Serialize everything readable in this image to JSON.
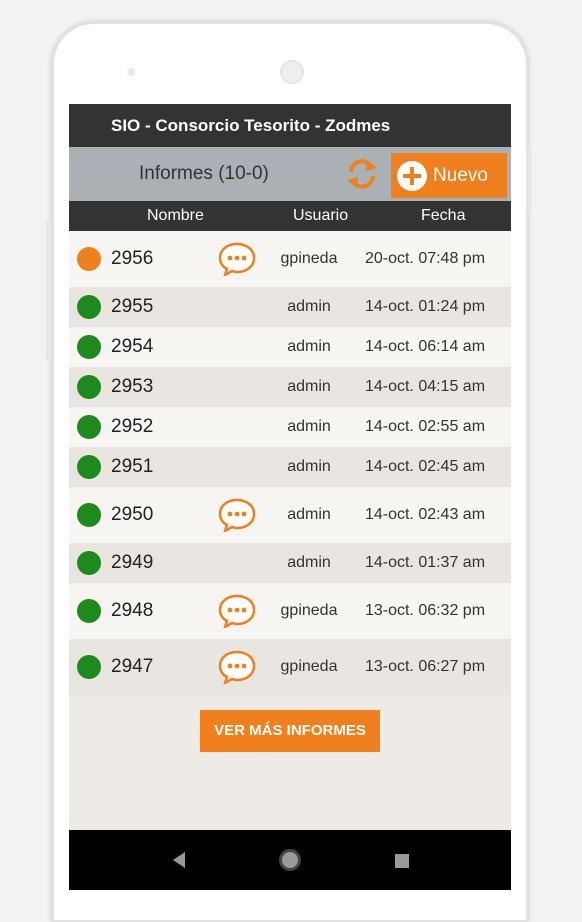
{
  "app": {
    "title": "SIO - Consorcio Tesorito - Zodmes"
  },
  "toolbar": {
    "count_label": "Informes (10-0)",
    "refresh_icon": "refresh-icon",
    "new_label": "Nuevo",
    "new_icon": "plus-circle-icon"
  },
  "table": {
    "headers": {
      "nombre": "Nombre",
      "usuario": "Usuario",
      "fecha": "Fecha"
    },
    "rows": [
      {
        "id": "2956",
        "status": "pending",
        "has_comment": true,
        "user": "gpineda",
        "date": "20-oct. 07:48 pm"
      },
      {
        "id": "2955",
        "status": "done",
        "has_comment": false,
        "user": "admin",
        "date": "14-oct. 01:24 pm"
      },
      {
        "id": "2954",
        "status": "done",
        "has_comment": false,
        "user": "admin",
        "date": "14-oct. 06:14 am"
      },
      {
        "id": "2953",
        "status": "done",
        "has_comment": false,
        "user": "admin",
        "date": "14-oct. 04:15 am"
      },
      {
        "id": "2952",
        "status": "done",
        "has_comment": false,
        "user": "admin",
        "date": "14-oct. 02:55 am"
      },
      {
        "id": "2951",
        "status": "done",
        "has_comment": false,
        "user": "admin",
        "date": "14-oct. 02:45 am"
      },
      {
        "id": "2950",
        "status": "done",
        "has_comment": true,
        "user": "admin",
        "date": "14-oct. 02:43 am"
      },
      {
        "id": "2949",
        "status": "done",
        "has_comment": false,
        "user": "admin",
        "date": "14-oct. 01:37 am"
      },
      {
        "id": "2948",
        "status": "done",
        "has_comment": true,
        "user": "gpineda",
        "date": "13-oct. 06:32 pm"
      },
      {
        "id": "2947",
        "status": "done",
        "has_comment": true,
        "user": "gpineda",
        "date": "13-oct. 06:27 pm"
      }
    ]
  },
  "more_button": {
    "label": "VER MÁS INFORMES"
  },
  "colors": {
    "accent": "#f07f1e",
    "status_pending": "#f07f1e",
    "status_done": "#1e8a1e",
    "header_bg": "#333333",
    "toolbar_bg": "#aab0b3"
  },
  "navbar": {
    "back_icon": "back-triangle-icon",
    "home_icon": "home-circle-icon",
    "recent_icon": "recent-square-icon"
  }
}
